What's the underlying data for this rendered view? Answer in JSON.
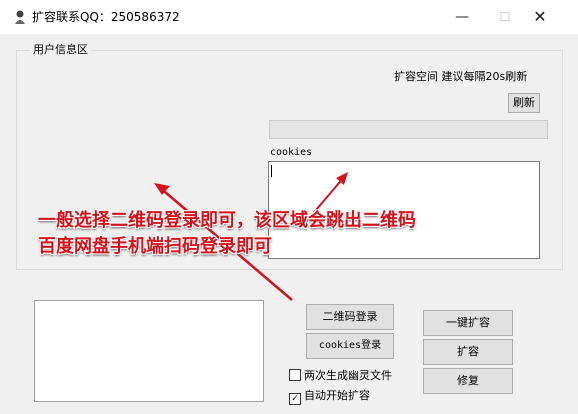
{
  "window": {
    "title": "扩容联系QQ：250586372",
    "min_icon": "minimize-icon",
    "max_icon": "maximize-icon",
    "close_icon": "close-icon"
  },
  "group": {
    "label": "用户信息区"
  },
  "tip": "扩容空间 建议每隔20s刷新",
  "refresh_label": "刷新",
  "cookies_label": "cookies",
  "cookies_value": "",
  "buttons": {
    "qr_login": "二维码登录",
    "cookies_login": "cookies登录",
    "one_click": "一键扩容",
    "expand": "扩容",
    "repair": "修复"
  },
  "checkboxes": [
    {
      "label": "两次生成幽灵文件",
      "checked": false
    },
    {
      "label": "自动开始扩容",
      "checked": true
    }
  ],
  "annotation": {
    "line1": "一般选择二维码登录即可，该区域会跳出二维码",
    "line2": "百度网盘手机端扫码登录即可",
    "color": "#d3131c"
  }
}
